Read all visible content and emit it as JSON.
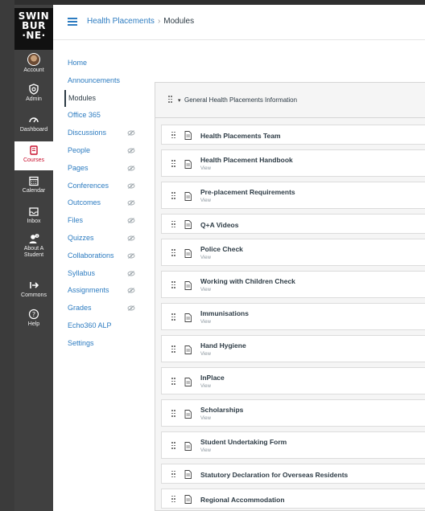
{
  "logo": {
    "lines": [
      "SWIN",
      "BUR",
      "·NE·"
    ]
  },
  "global_nav": {
    "items": [
      {
        "id": "account",
        "label": "Account",
        "icon": "avatar-icon"
      },
      {
        "id": "admin",
        "label": "Admin",
        "icon": "shield-icon"
      },
      {
        "id": "dashboard",
        "label": "Dashboard",
        "icon": "speedometer-icon"
      },
      {
        "id": "courses",
        "label": "Courses",
        "icon": "book-icon",
        "active": true
      },
      {
        "id": "calendar",
        "label": "Calendar",
        "icon": "calendar-icon"
      },
      {
        "id": "inbox",
        "label": "Inbox",
        "icon": "inbox-icon"
      },
      {
        "id": "about",
        "label": "About A Student",
        "icon": "person-info-icon"
      },
      {
        "id": "commons",
        "label": "Commons",
        "icon": "commons-arrow-icon"
      },
      {
        "id": "help",
        "label": "Help",
        "icon": "help-icon"
      }
    ]
  },
  "breadcrumb": {
    "course": "Health Placements",
    "separator": "›",
    "current": "Modules"
  },
  "course_nav": {
    "items": [
      {
        "label": "Home",
        "hidden": false
      },
      {
        "label": "Announcements",
        "hidden": false
      },
      {
        "label": "Modules",
        "hidden": false,
        "active": true
      },
      {
        "label": "Office 365",
        "hidden": false
      },
      {
        "label": "Discussions",
        "hidden": true
      },
      {
        "label": "People",
        "hidden": true
      },
      {
        "label": "Pages",
        "hidden": true
      },
      {
        "label": "Conferences",
        "hidden": true
      },
      {
        "label": "Outcomes",
        "hidden": true
      },
      {
        "label": "Files",
        "hidden": true
      },
      {
        "label": "Quizzes",
        "hidden": true
      },
      {
        "label": "Collaborations",
        "hidden": true
      },
      {
        "label": "Syllabus",
        "hidden": true
      },
      {
        "label": "Assignments",
        "hidden": true
      },
      {
        "label": "Grades",
        "hidden": true
      },
      {
        "label": "Echo360 ALP",
        "hidden": false
      },
      {
        "label": "Settings",
        "hidden": false
      }
    ]
  },
  "module": {
    "title": "General Health Placements Information",
    "items": [
      {
        "name": "Health Placements Team",
        "sub": ""
      },
      {
        "name": "Health Placement Handbook",
        "sub": "View"
      },
      {
        "name": "Pre-placement Requirements",
        "sub": "View"
      },
      {
        "name": "Q+A Videos",
        "sub": ""
      },
      {
        "name": "Police Check",
        "sub": "View"
      },
      {
        "name": "Working with Children Check",
        "sub": "View"
      },
      {
        "name": "Immunisations",
        "sub": "View"
      },
      {
        "name": "Hand Hygiene",
        "sub": "View"
      },
      {
        "name": "InPlace",
        "sub": "View"
      },
      {
        "name": "Scholarships",
        "sub": "View"
      },
      {
        "name": "Student Undertaking Form",
        "sub": "View"
      },
      {
        "name": "Statutory Declaration for Overseas Residents",
        "sub": ""
      },
      {
        "name": "Regional Accommodation",
        "sub": ""
      }
    ]
  },
  "colors": {
    "link": "#2d7cc1",
    "nav_bg": "#404040",
    "accent": "#c8102e"
  }
}
